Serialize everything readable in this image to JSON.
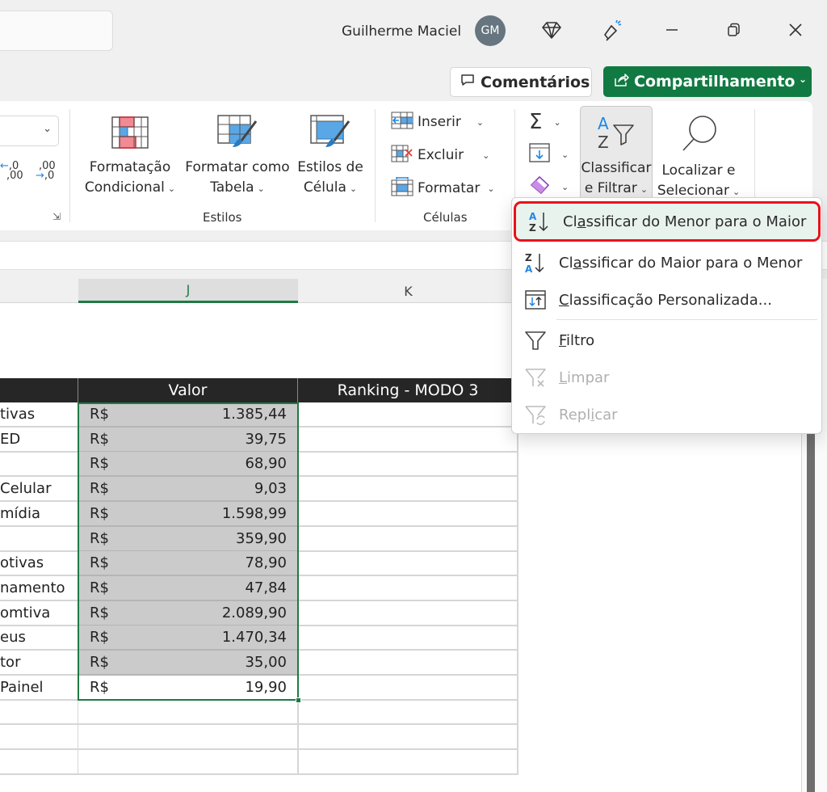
{
  "titlebar": {
    "user_name": "Guilherme Maciel",
    "avatar_initials": "GM",
    "icons": [
      "diamond-icon",
      "megaphone-icon",
      "minimize-icon",
      "restore-icon",
      "close-icon"
    ]
  },
  "actions": {
    "comments_label": "Comentários",
    "share_label": "Compartilhamento"
  },
  "ribbon": {
    "number_group": {
      "increase_decimal": [
        "←,0",
        ",00"
      ],
      "decrease_decimal": [
        ",00",
        "→,0"
      ]
    },
    "styles_group": {
      "label": "Estilos",
      "buttons": [
        {
          "line1": "Formatação",
          "line2": "Condicional"
        },
        {
          "line1": "Formatar como",
          "line2": "Tabela"
        },
        {
          "line1": "Estilos de",
          "line2": "Célula"
        }
      ]
    },
    "cells_group": {
      "label": "Células",
      "buttons": [
        "Inserir",
        "Excluir",
        "Formatar"
      ]
    },
    "editing_group": {
      "sort_filter": {
        "line1": "Classificar",
        "line2": "e Filtrar"
      },
      "find_select": {
        "line1": "Localizar e",
        "line2": "Selecionar"
      }
    }
  },
  "sheet": {
    "columns": [
      "J",
      "K"
    ],
    "table_headers": [
      "Valor",
      "Ranking - MODO 3"
    ],
    "rows": [
      {
        "label": "tivas",
        "currency": "R$",
        "value": "1.385,44"
      },
      {
        "label": "ED",
        "currency": "R$",
        "value": "39,75"
      },
      {
        "label": "",
        "currency": "R$",
        "value": "68,90"
      },
      {
        "label": "Celular",
        "currency": "R$",
        "value": "9,03"
      },
      {
        "label": "mídia",
        "currency": "R$",
        "value": "1.598,99"
      },
      {
        "label": "",
        "currency": "R$",
        "value": "359,90"
      },
      {
        "label": "otivas",
        "currency": "R$",
        "value": "78,90"
      },
      {
        "label": "namento",
        "currency": "R$",
        "value": "47,84"
      },
      {
        "label": "omtiva",
        "currency": "R$",
        "value": "2.089,90"
      },
      {
        "label": "eus",
        "currency": "R$",
        "value": "1.470,34"
      },
      {
        "label": "tor",
        "currency": "R$",
        "value": "35,00"
      },
      {
        "label": "Painel",
        "currency": "R$",
        "value": "19,90"
      }
    ]
  },
  "menu": {
    "items": [
      {
        "pre": "Cl",
        "u": "a",
        "post": "ssificar do Menor para o Maior",
        "icon": "sort-ascending-icon",
        "state": "highlighted"
      },
      {
        "pre": "Cl",
        "u": "a",
        "post": "ssificar do Maior para o Menor",
        "icon": "sort-descending-icon",
        "state": "normal"
      },
      {
        "pre": "",
        "u": "C",
        "post": "lassificação Personalizada...",
        "icon": "custom-sort-icon",
        "state": "normal"
      },
      {
        "pre": "",
        "u": "F",
        "post": "iltro",
        "icon": "filter-icon",
        "state": "normal"
      },
      {
        "pre": "",
        "u": "L",
        "post": "impar",
        "icon": "clear-filter-icon",
        "state": "disabled"
      },
      {
        "pre": "Repl",
        "u": "i",
        "post": "car",
        "icon": "reapply-filter-icon",
        "state": "disabled"
      }
    ]
  },
  "colors": {
    "accent_green": "#117a42",
    "selection_green": "#1f7a44",
    "highlight_red": "#e8121b"
  }
}
